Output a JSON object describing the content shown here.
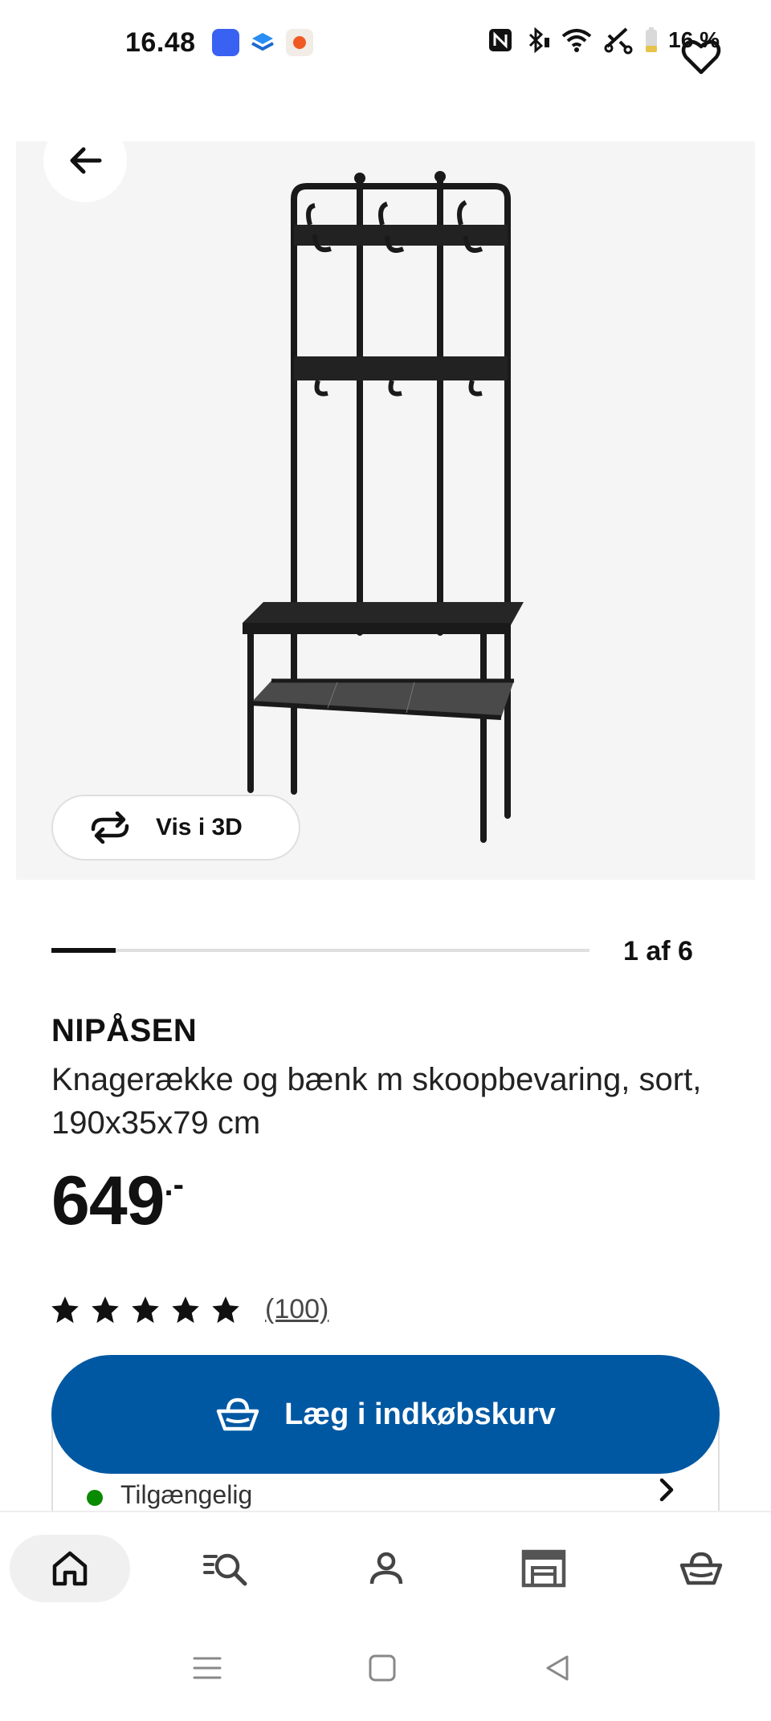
{
  "status_bar": {
    "time": "16.48",
    "battery_percent": "16 %"
  },
  "product": {
    "name": "NIPÅSEN",
    "description": "Knagerække og bænk m skoopbevaring, sort, 190x35x79 cm",
    "price": "649",
    "price_suffix": ".-",
    "rating_stars": 5,
    "rating_count": "(100)"
  },
  "gallery": {
    "view_3d_label": "Vis i 3D",
    "pager_text": "1 af 6",
    "current_index": 1,
    "total": 6
  },
  "actions": {
    "add_to_cart_label": "Læg i indkøbskurv"
  },
  "availability": {
    "label": "Tilgængelig",
    "status_color": "#0a8a00"
  },
  "bottom_nav": {
    "items": [
      "home-icon",
      "search-list-icon",
      "profile-icon",
      "store-icon",
      "basket-icon"
    ],
    "active": "home-icon"
  },
  "colors": {
    "brand_blue": "#0058a3",
    "text": "#111111"
  }
}
